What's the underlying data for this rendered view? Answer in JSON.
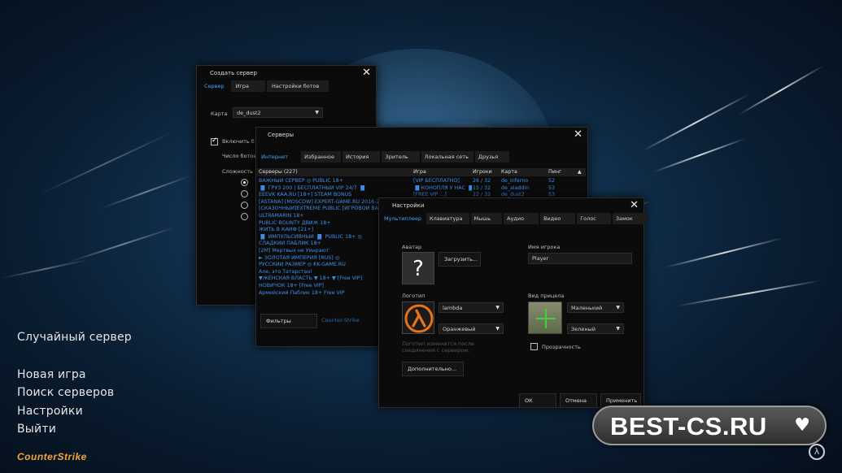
{
  "main_menu": {
    "items": [
      "Случайный сервер",
      "Новая игра",
      "Поиск серверов",
      "Настройки",
      "Выйти"
    ],
    "logo": "CounterStrike"
  },
  "create_server": {
    "title": "Создать сервер",
    "tabs": [
      "Сервер",
      "Игра",
      "Настройки ботов"
    ],
    "map_label": "Карта",
    "map_value": "de_dust2",
    "enable_bots_label": "Включить б",
    "bots_count_label": "Число ботов",
    "difficulty_label": "Сложность"
  },
  "servers": {
    "title": "Серверы",
    "tabs": [
      "Интернет",
      "Избранное",
      "История",
      "Зритель",
      "Локальная сеть",
      "Друзья"
    ],
    "columns": [
      "Серверы (227)",
      "Игра",
      "Игроки",
      "Карта",
      "Пинг"
    ],
    "rows": [
      {
        "name": "ВАЖНЫЙ СЕРВЕР ◎ PUBLIC 18+",
        "game": "[VIP БЕСПЛАТНО]",
        "players": "26 / 32",
        "map": "de_inferno",
        "ping": "52"
      },
      {
        "name": "▐▌ ГРУЗ 200 | БЕСПЛАТНЫЙ VIP 24/7 ▐▌",
        "game": "▐▌КОНОПЛЯ У НАС ▐▌",
        "players": "15 / 32",
        "map": "de_aladdin",
        "ping": "53"
      },
      {
        "name": "EEEVK KAA.RU [18+] STEAM BONUS",
        "game": "[FREE VIP ...]",
        "players": "22 / 32",
        "map": "de_dust2",
        "ping": "53"
      },
      {
        "name": "[ASTANA] [MOSCOW] EXPERT-GAME.RU 2016-2",
        "game": "",
        "players": "",
        "map": "",
        "ping": ""
      },
      {
        "name": "[СКАЗОЧНЫЙ]EXTREME PUBLIC [ИГРОВОЙ ВА",
        "game": "",
        "players": "",
        "map": "",
        "ping": ""
      },
      {
        "name": "ULTRAMARIN 18+",
        "game": "",
        "players": "",
        "map": "",
        "ping": ""
      },
      {
        "name": "PUBLIC BOUNTY ДВИЖ 18+",
        "game": "",
        "players": "",
        "map": "",
        "ping": ""
      },
      {
        "name": "ЖИТЬ В КАЙФ [21+]",
        "game": "",
        "players": "",
        "map": "",
        "ping": ""
      },
      {
        "name": "▐▌ ИМПУЛЬСИВНЫЙ ▐▌ PUBLIC 18+ ◎",
        "game": "",
        "players": "",
        "map": "",
        "ping": ""
      },
      {
        "name": "СЛАДКИЙ ПАБЛИК 18+",
        "game": "",
        "players": "",
        "map": "",
        "ping": ""
      },
      {
        "name": "[2M] Мертвых не Уинрают",
        "game": "",
        "players": "",
        "map": "",
        "ping": ""
      },
      {
        "name": "► ЗОЛОТАЯ ИМПЕРИЯ [RUS] ◎",
        "game": "",
        "players": "",
        "map": "",
        "ping": ""
      },
      {
        "name": "РУССКИЙ РАЗМЕР ◎ KK-GAME.RU",
        "game": "",
        "players": "",
        "map": "",
        "ping": ""
      },
      {
        "name": "Але, это Татарстан!",
        "game": "",
        "players": "",
        "map": "",
        "ping": ""
      },
      {
        "name": "▼ЖЕНСКАЯ ВЛАСТЬ ▼ 18+ ▼ [Free VIP]",
        "game": "",
        "players": "",
        "map": "",
        "ping": ""
      },
      {
        "name": "НОВИЧОК 18+ [Free VIP]",
        "game": "",
        "players": "",
        "map": "",
        "ping": ""
      },
      {
        "name": "Армейский Паблик 18+ Free VIP",
        "game": "",
        "players": "",
        "map": "",
        "ping": ""
      }
    ],
    "filters_button": "Фильтры",
    "filter_game": "Counter-Strike"
  },
  "settings": {
    "title": "Настройки",
    "tabs": [
      "Мультиплеер",
      "Клавиатура",
      "Мышь",
      "Аудио",
      "Видео",
      "Голос",
      "Замок"
    ],
    "avatar_label": "Аватар",
    "upload_button": "Загрузить...",
    "avatar_placeholder": "?",
    "player_name_label": "Имя игрока",
    "player_name_value": "Player",
    "logo_label": "Логотип",
    "logo_value": "lambda",
    "logo_color": "Оранжевый",
    "logo_note": "Логотип изменится после соединения с сервером.",
    "crosshair_label": "Вид прицела",
    "crosshair_size": "Маленький",
    "crosshair_color": "Зеленый",
    "transparency_label": "Прозрачность",
    "advanced_button": "Дополнительно...",
    "ok_button": "ОК",
    "cancel_button": "Отмена",
    "apply_button": "Применить"
  },
  "badge": {
    "text": "BEST-CS.RU"
  },
  "colors": {
    "accent": "#3fa7ff",
    "server_text": "#3d8fe8",
    "logo_orange": "#e8741a"
  }
}
